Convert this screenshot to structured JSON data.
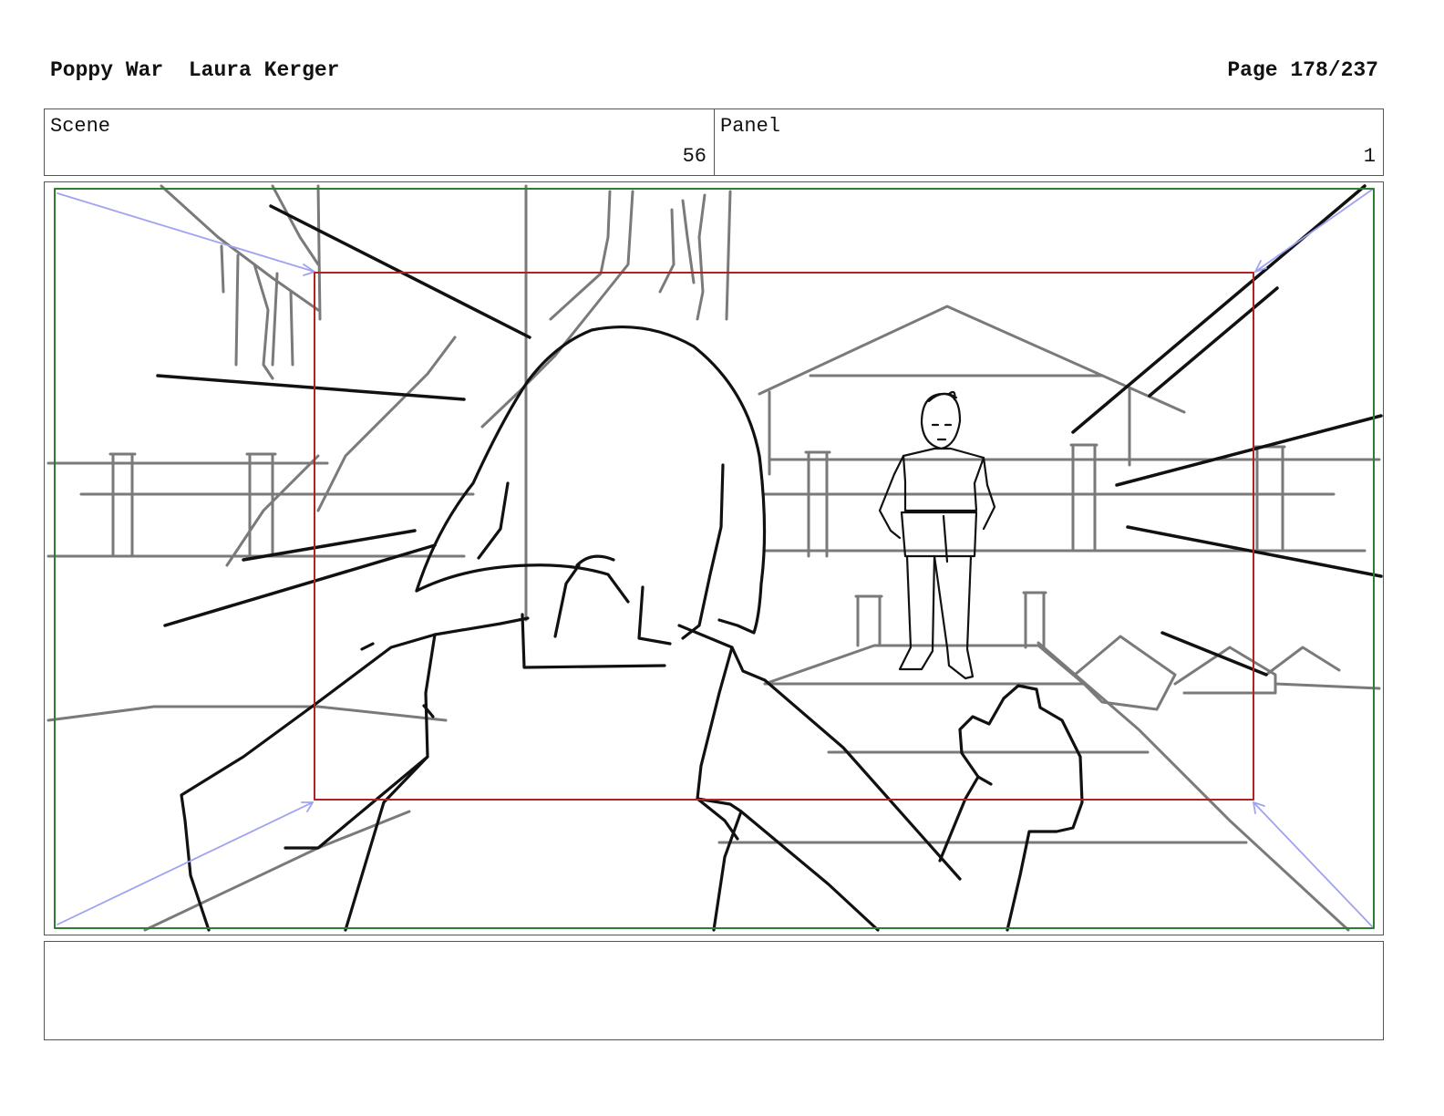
{
  "header": {
    "project_title": "Poppy War",
    "artist": "Laura Kerger",
    "page_label": "Page 178/237"
  },
  "info": {
    "scene_label": "Scene",
    "scene_value": "56",
    "panel_label": "Panel",
    "panel_value": "1"
  },
  "notes": {
    "text": ""
  },
  "colors": {
    "safe_frame": "#2e7d32",
    "action_frame": "#b22222",
    "camera_arrows": "#9fa3f0",
    "ink": "#111111",
    "background_ink": "#7a7a7a"
  }
}
